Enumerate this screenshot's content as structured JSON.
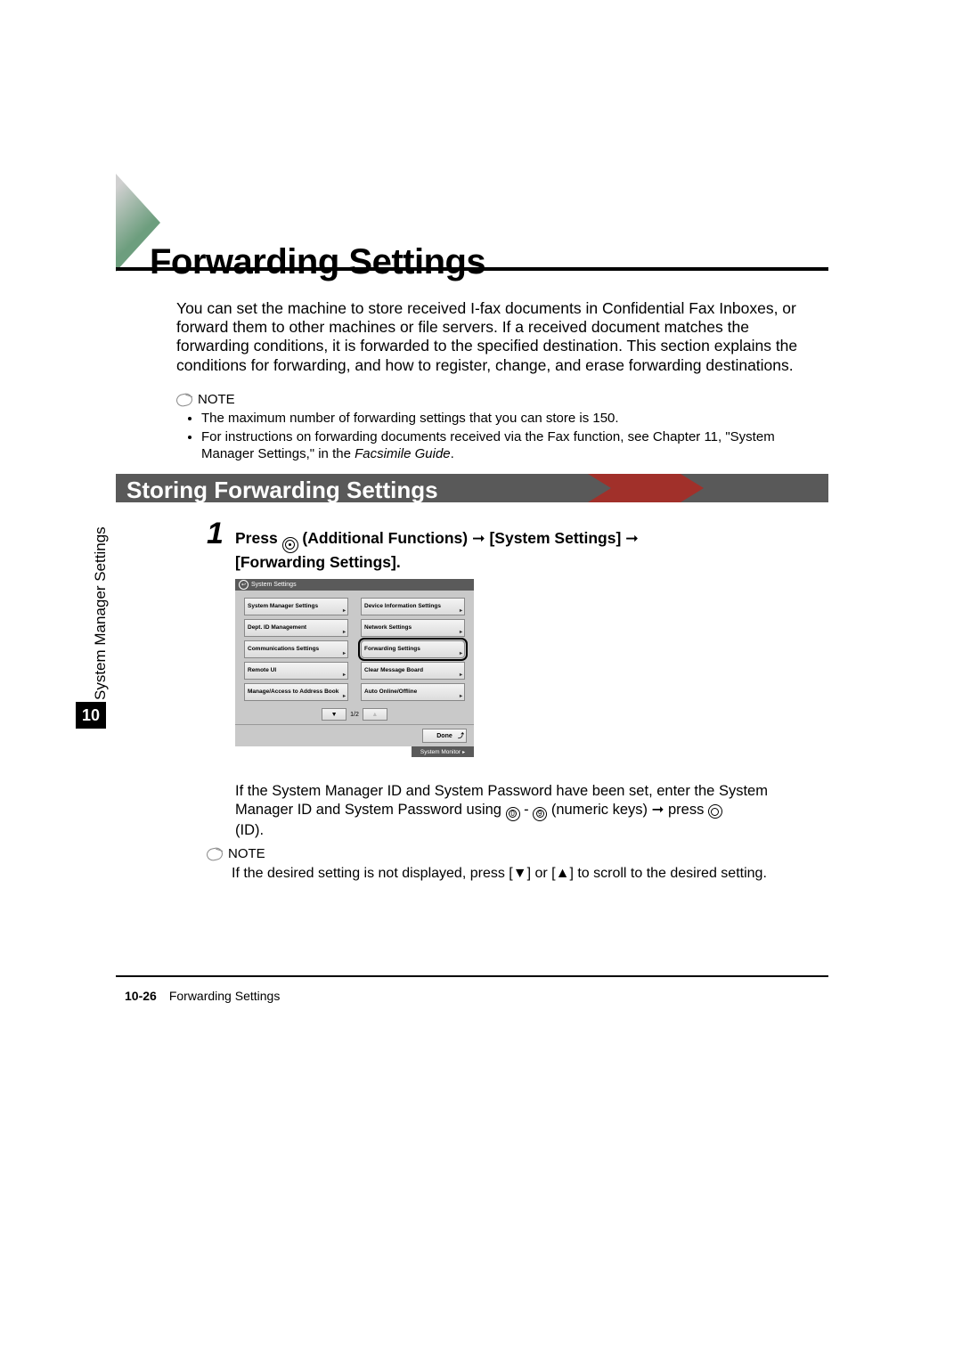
{
  "heading": "Forwarding Settings",
  "intro": "You can set the machine to store received I-fax documents in Confidential Fax Inboxes, or forward them to other machines or file servers. If a received document matches the forwarding conditions, it is forwarded to the specified destination. This section explains the conditions for forwarding, and how to register, change, and erase forwarding destinations.",
  "note1": {
    "label": "NOTE",
    "items": [
      "The maximum number of forwarding settings that you can store is 150.",
      "For instructions on forwarding documents received via the Fax function, see Chapter 11, \"System Manager Settings,\" in the "
    ],
    "italic_tail": "Facsimile Guide",
    "tail_after_italic": "."
  },
  "section_title": "Storing Forwarding Settings",
  "side_tab": {
    "label": "System Manager Settings",
    "number": "10"
  },
  "step": {
    "number": "1",
    "line1_a": "Press ",
    "line1_b": " (Additional Functions) ",
    "line1_c": " [System Settings] ",
    "line1_d": " [Forwarding Settings]."
  },
  "screen": {
    "title": "System Settings",
    "buttons_left": [
      "System Manager Settings",
      "Dept. ID Management",
      "Communications Settings",
      "Remote UI",
      "Manage/Access to Address Book"
    ],
    "buttons_right": [
      "Device Information Settings",
      "Network Settings",
      "Forwarding Settings",
      "Clear Message Board",
      "Auto Online/Offline"
    ],
    "highlighted_right_index": 2,
    "pager": "1/2",
    "done": "Done",
    "sysmon": "System Monitor"
  },
  "after_screen": {
    "line1": "If the System Manager ID and System Password have been set, enter the System Manager ID and System Password using ",
    "mid": " - ",
    "tail1": " (numeric keys) ",
    "tail2": " press ",
    "line3": "(ID)."
  },
  "note2": {
    "label": "NOTE",
    "text_a": "If the desired setting is not displayed, press [",
    "text_b": "] or [",
    "text_c": "] to scroll to the desired setting."
  },
  "footer": {
    "page": "10-26",
    "title": "Forwarding Settings"
  }
}
